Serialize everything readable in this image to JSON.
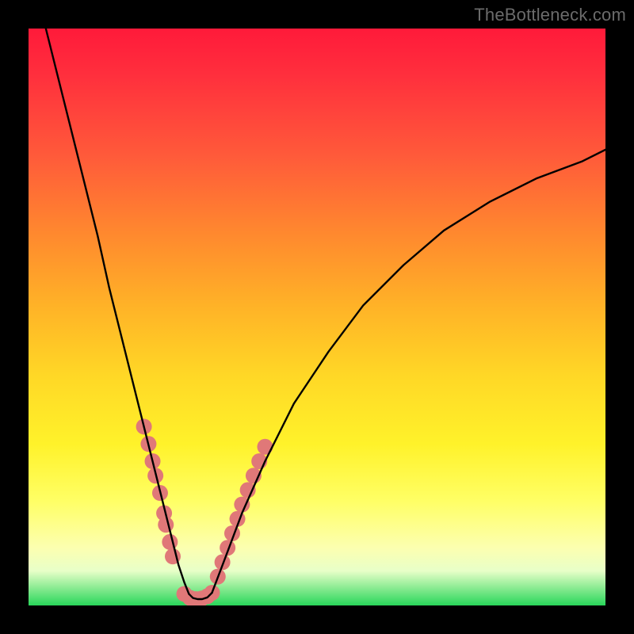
{
  "watermark": {
    "text": "TheBottleneck.com"
  },
  "chart_data": {
    "type": "line",
    "title": "",
    "xlabel": "",
    "ylabel": "",
    "xlim": [
      0,
      100
    ],
    "ylim": [
      0,
      100
    ],
    "grid": false,
    "legend": false,
    "gradient_stops": [
      {
        "pos": 0,
        "color": "#ff1a3a"
      },
      {
        "pos": 36,
        "color": "#ff8a2e"
      },
      {
        "pos": 72,
        "color": "#fff22a"
      },
      {
        "pos": 94,
        "color": "#e8ffc8"
      },
      {
        "pos": 100,
        "color": "#29d65a"
      }
    ],
    "series": [
      {
        "name": "left-branch",
        "color": "#000000",
        "x": [
          3,
          6,
          9,
          12,
          14,
          16,
          18,
          20,
          21,
          22,
          23,
          24,
          25,
          26,
          27,
          27.8
        ],
        "y": [
          100,
          88,
          76,
          64,
          55,
          47,
          39,
          31,
          27,
          23,
          19,
          15,
          11,
          7,
          4,
          2
        ]
      },
      {
        "name": "valley-floor",
        "color": "#000000",
        "x": [
          27.8,
          28.5,
          29.3,
          30.1,
          31.0,
          31.8
        ],
        "y": [
          2,
          1.3,
          1.1,
          1.1,
          1.4,
          2.2
        ]
      },
      {
        "name": "right-branch",
        "color": "#000000",
        "x": [
          31.8,
          34,
          37,
          41,
          46,
          52,
          58,
          65,
          72,
          80,
          88,
          96,
          100
        ],
        "y": [
          2.2,
          8,
          16,
          25,
          35,
          44,
          52,
          59,
          65,
          70,
          74,
          77,
          79
        ]
      }
    ],
    "markers": [
      {
        "name": "left-dots",
        "color": "#e07878",
        "radius": 10,
        "x": [
          20.0,
          20.8,
          21.5,
          22.0,
          22.8,
          23.5,
          23.8,
          24.5,
          25.0
        ],
        "y": [
          31.0,
          28.0,
          25.0,
          22.5,
          19.5,
          16.0,
          14.0,
          11.0,
          8.5
        ]
      },
      {
        "name": "floor-dots",
        "color": "#e07878",
        "radius": 10,
        "x": [
          27.0,
          28.0,
          29.0,
          30.0,
          31.0,
          31.8
        ],
        "y": [
          2.0,
          1.3,
          1.1,
          1.2,
          1.6,
          2.2
        ]
      },
      {
        "name": "right-dots",
        "color": "#e07878",
        "radius": 10,
        "x": [
          32.8,
          33.6,
          34.5,
          35.3,
          36.2,
          37.0,
          38.0,
          39.0,
          40.0,
          41.0
        ],
        "y": [
          5.0,
          7.5,
          10.0,
          12.5,
          15.0,
          17.5,
          20.0,
          22.5,
          25.0,
          27.5
        ]
      }
    ]
  }
}
